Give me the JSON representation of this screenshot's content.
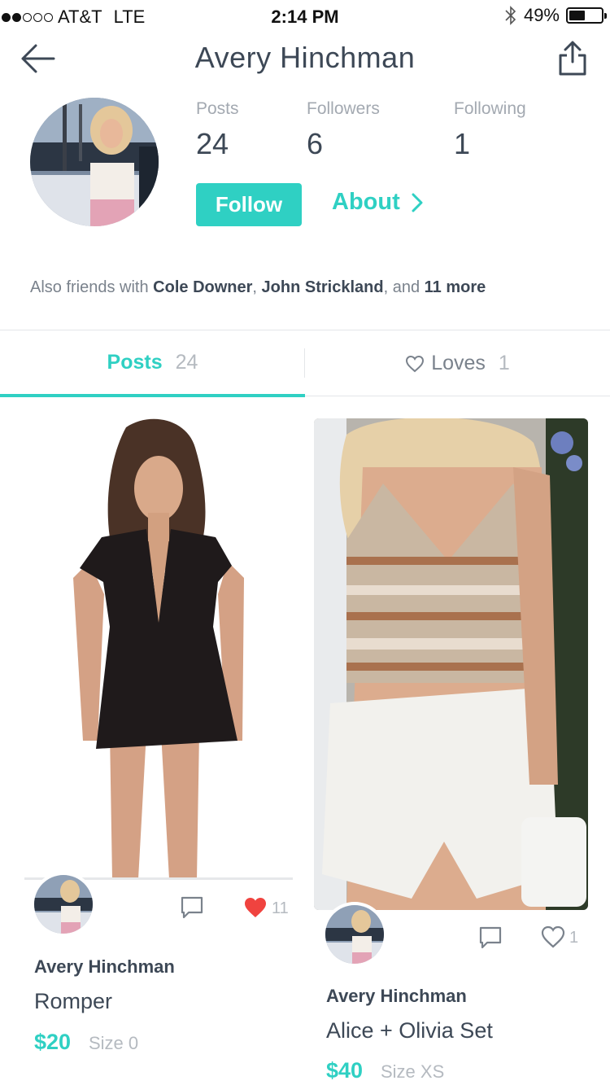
{
  "status_bar": {
    "carrier": "AT&T",
    "network": "LTE",
    "time": "2:14 PM",
    "battery": "49%",
    "battery_level": 0.49,
    "signal_bars": 2
  },
  "header": {
    "title": "Avery Hinchman",
    "back_icon": "arrow-left-icon",
    "share_icon": "share-icon"
  },
  "profile": {
    "stats": [
      {
        "label": "Posts",
        "value": "24"
      },
      {
        "label": "Followers",
        "value": "6"
      },
      {
        "label": "Following",
        "value": "1"
      }
    ],
    "follow_label": "Follow",
    "about_label": "About"
  },
  "friends": {
    "prefix": "Also friends with",
    "names": [
      "Cole Downer",
      "John Strickland"
    ],
    "sep1": ",",
    "sep2": ", and",
    "more": "11 more"
  },
  "tabs": [
    {
      "label": "Posts",
      "count": "24"
    },
    {
      "label": "Loves",
      "count": "1"
    }
  ],
  "posts": [
    {
      "author": "Avery Hinchman",
      "title": "Romper",
      "price": "$20",
      "size": "Size 0",
      "likes": "11",
      "liked": true
    },
    {
      "author": "Avery Hinchman",
      "title": "Alice + Olivia Set",
      "price": "$40",
      "size": "Size XS",
      "likes": "1",
      "liked": false
    }
  ],
  "colors": {
    "accent": "#2fd0c3",
    "text_dark": "#3d4856",
    "text_muted": "#a3a9b1",
    "like_red": "#f0433f"
  }
}
